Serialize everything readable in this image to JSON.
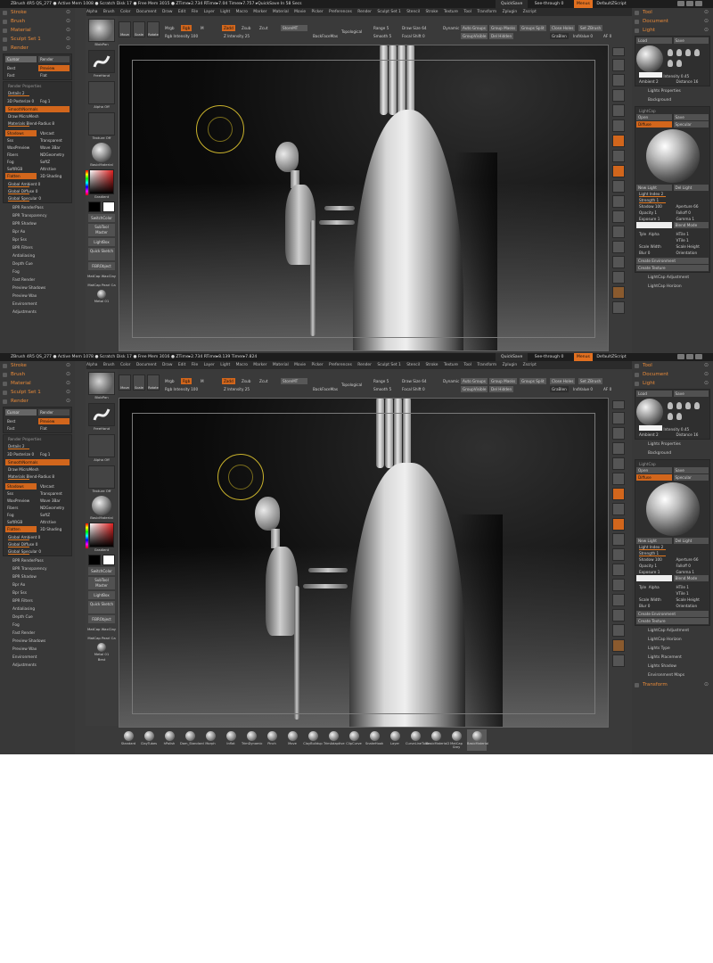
{
  "app": {
    "title_line": "ZBrush 4R5    QS_277    ● Active Mem 1008 ● Scratch Disk 17 ● Free Mem 3015 ● ZTime▸2.734 RTime▸7.04 Timer▸7.757 ▸QuickSave In 58 Secs",
    "title_line_b": "ZBrush 4R5    QS_277    ● Active Mem 1078 ● Scratch Disk 17 ● Free Mem 3016 ● ZTime▸2.734 RTime▸8.139 Timer▸7.824",
    "quicksave": "QuickSave",
    "see_through": "See-through   0",
    "menus": "Menus",
    "default_script": "DefaultZScript"
  },
  "menubar": [
    "Alpha",
    "Brush",
    "Color",
    "Document",
    "Draw",
    "Edit",
    "File",
    "Layer",
    "Light",
    "Macro",
    "Marker",
    "Material",
    "Movie",
    "Picker",
    "Preferences",
    "Render",
    "Sculpt Set 1",
    "Stencil",
    "Stroke",
    "Texture",
    "Tool",
    "Transform",
    "Zplugin",
    "Zscript"
  ],
  "left_palette": {
    "headers": [
      "Stroke",
      "Brush",
      "Material",
      "Sculpt Set 1",
      "Render"
    ],
    "render_tabs": [
      "Cursor",
      "Render"
    ],
    "render_modes": [
      "Best",
      "Preview",
      "Fast",
      "Flat"
    ],
    "render_properties_title": "Render Properties",
    "details": "Details 2",
    "rp_row1": [
      "3D Posterize 0",
      "Fog 1"
    ],
    "smooth_normals": "SmoothNormals",
    "draw_micromesh": "Draw MicroMesh",
    "materials_blend_radius": "Materials Blend-Radius 8",
    "shadows_grid": [
      "Shadows",
      "Vbrcast",
      "Attrctive",
      "Sss",
      "Transparent",
      "WaxPreview",
      "Wave 3Bar",
      "Fibers",
      "NDGeometry",
      "Fog",
      "SoftZ",
      "SoftRGB",
      "Flatten",
      "3D Shading"
    ],
    "global_rows": [
      "Global Ambient 0",
      "Global Diffuse 0",
      "Global Specular 0"
    ],
    "bottom_items": [
      "BPR RenderPass",
      "BPR Transparency",
      "BPR Shadow",
      "Bpr Ao",
      "Bpr Sss",
      "BPR Filters",
      "Antialiasing",
      "Depth Cue",
      "Fog",
      "Fast Render",
      "Preview Shadows",
      "Preview Wax",
      "Environment",
      "Adjustments"
    ]
  },
  "tool_shelf": {
    "brush_label": "BlobPan",
    "stroke_label": "FreeHand",
    "alpha_label": "Alpha Off",
    "texture_label": "Texture Off",
    "material_label": "BasicMaterial",
    "gradient_label": "Gradient",
    "switch_color": "SwitchColor",
    "subtool_master": "SubTool Master",
    "lightbox": "LightBox",
    "quick_sketch": "Quick Sketch",
    "fibrmesh": "FiBRObject",
    "matcap_wax": "MatCap WaxClay",
    "matcap_pearl": "MatCap Pearl Ca",
    "metal": "Metal 01",
    "best": "Best"
  },
  "top_shelf": {
    "edit": "Edit",
    "draw": "Draw",
    "move": "Move",
    "scale": "Scale",
    "rotate": "Rotate",
    "mrgb": "Mrgb",
    "rgb": "Rgb",
    "m": "M",
    "rgb_intensity": "Rgb Intensity 100",
    "zadd": "Zadd",
    "zsub": "Zsub",
    "z_intensity": "Z Intensity 25",
    "zcut": "Zcut",
    "storemt": "StoreMT",
    "backfacemask": "BackFaceMas",
    "topological": "Topological",
    "range": "Range 5",
    "smooth": "Smooth 5",
    "draw_size": "Draw Size 64",
    "dynamic": "Dynamic",
    "focal_shift": "Focal Shift 0",
    "auto_groups": "Auto Groups",
    "group_masks": "Group Masks",
    "groups_split": "Groups Split",
    "close_holes": "Close Holes",
    "set_zbrush": "Set ZBrush",
    "groupvisible": "GroupVisible",
    "del_hidden": "Del Hidden",
    "gradius": "GraBlen",
    "ind_value": "IndValue 0",
    "af": "AF 0"
  },
  "right_dock": [
    "Scroll",
    "Zoom",
    "Actual",
    "AAHalf",
    "Persp",
    "Floor",
    "Local",
    "LSym",
    "Xyz",
    "Frame",
    "Move",
    "Scale",
    "Rotate",
    "PolyF",
    "Transp",
    "Ghost",
    "Solo",
    "Xpose"
  ],
  "right_palette": {
    "headers": [
      "Tool",
      "Document",
      "Light"
    ],
    "load": "Load",
    "save": "Save",
    "intensity": "Intensity 0.45",
    "ambient": "Ambient 2",
    "distance": "Distance 16",
    "lights_properties": "Lights Properties",
    "background": "Background",
    "lightcap_title": "LightCap",
    "open": "Open",
    "save2": "Save",
    "diffuse": "Diffuse",
    "specular": "Specular",
    "new_light": "New Light",
    "del_light": "Del Light",
    "light_index": "Light Index 2",
    "strength": "Strength 1",
    "shadow": "Shadow 100",
    "aperture": "Aperture 66",
    "opacity": "Opacity 1",
    "falloff": "Falloff 0",
    "exposure": "Exposure 1",
    "gamma": "Gamma 1",
    "blend_mode": "Blend Mode",
    "tyle": "Tyle",
    "alpha": "Alpha",
    "htile": "HTile 1",
    "vtile": "VTile 1",
    "scale_width": "Scale Width",
    "scale_height": "Scale Height",
    "blur": "Blur 0",
    "orientation": "Orientation",
    "create_environment": "Create Environment",
    "create_texture": "Create Texture",
    "lightcap_adjustment": "LightCap Adjustment",
    "lightcap_horizon": "LightCap Horizon",
    "lights_type": "Lights Type",
    "lights_placement": "Lights Placement",
    "lights_shadow": "Lights Shadow",
    "environment_maps": "Environment Maps",
    "transform": "Transform"
  },
  "brush_shelf": [
    "Standard",
    "ClayTubes",
    "hPolish",
    "Dam_Standard",
    "Morph",
    "Inflat",
    "TrimDynamic",
    "Pinch",
    "Move",
    "ClayBuildup",
    "TrimAdaptive",
    "ClipCurve",
    "SnakeHook",
    "Layer",
    "CurveLineTube",
    "BasicMaterial2",
    "MatCap Grey",
    "BasicMaterial"
  ],
  "colors": {
    "accent": "#d2661c",
    "panel": "#383838",
    "brush_ring": "#c9b22c"
  }
}
